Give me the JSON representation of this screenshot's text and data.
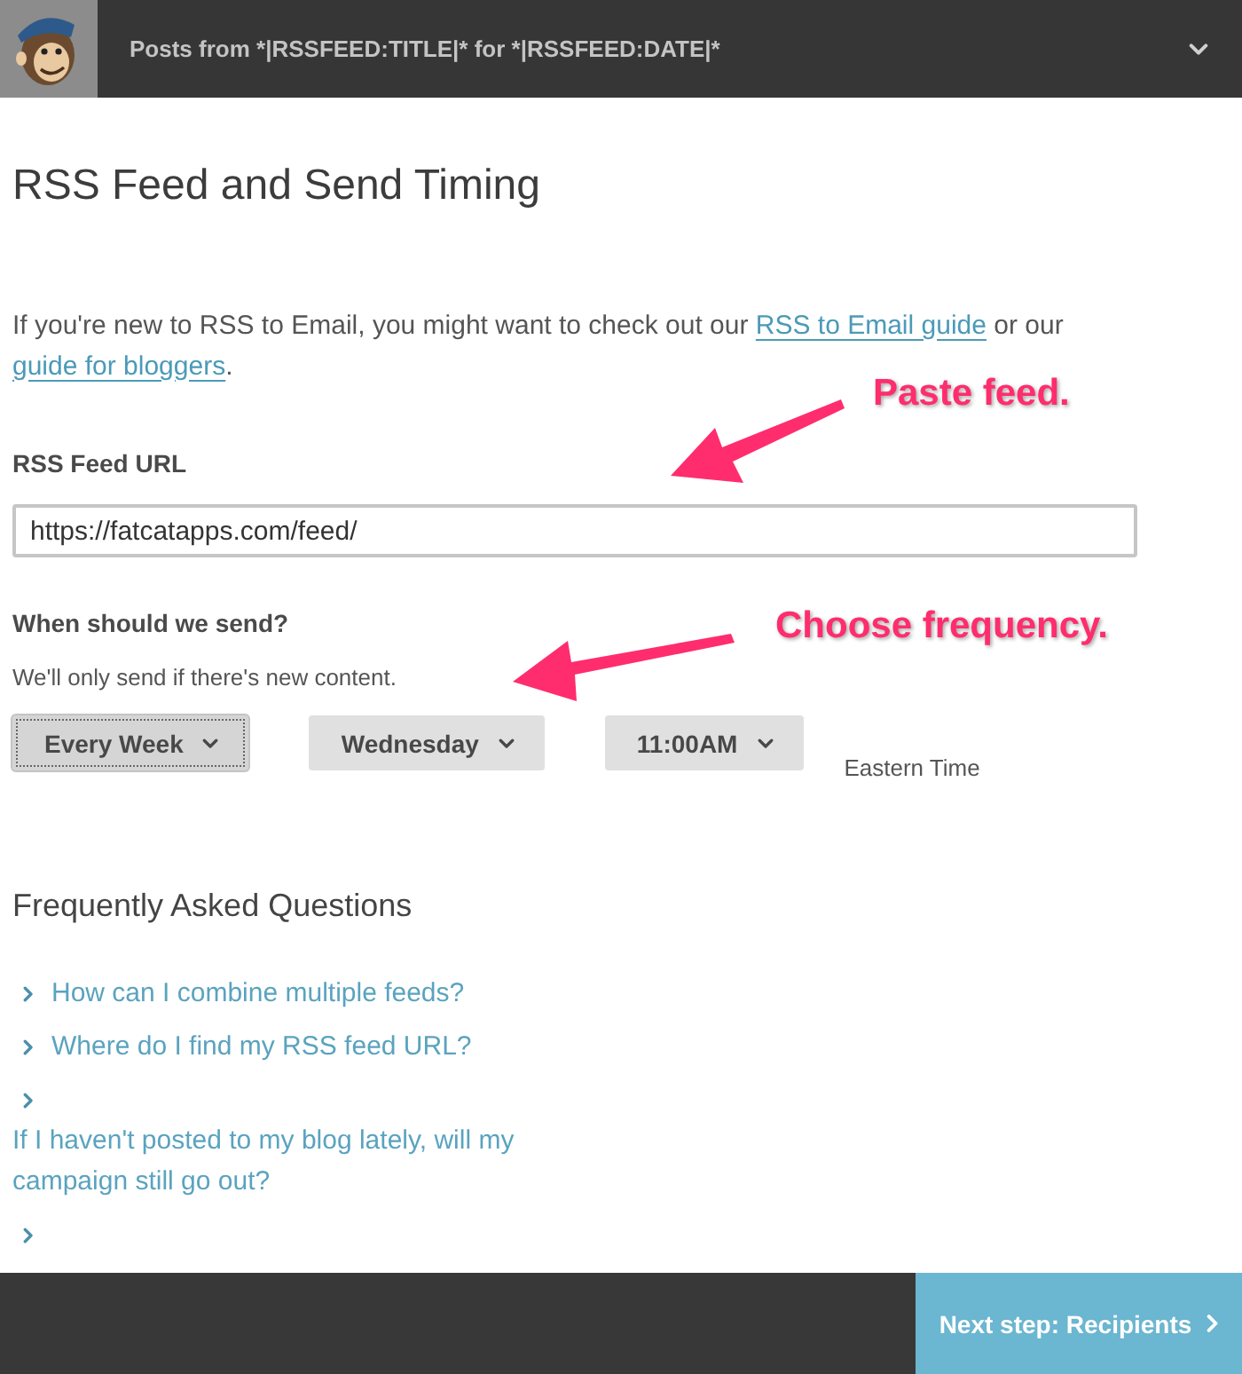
{
  "header": {
    "title": "Posts from *|RSSFEED:TITLE|* for *|RSSFEED:DATE|*"
  },
  "heading": "RSS Feed and Send Timing",
  "intro": [
    {
      "kind": "text",
      "text": "If you're new to RSS to Email, you might want to check out our "
    },
    {
      "kind": "link",
      "text": "RSS to Email guide"
    },
    {
      "kind": "text",
      "text": " or our "
    },
    {
      "kind": "link",
      "text": "guide for bloggers"
    },
    {
      "kind": "text",
      "text": "."
    }
  ],
  "feed_url": {
    "label": "RSS Feed URL",
    "value": "https://fatcatapps.com/feed/"
  },
  "schedule": {
    "title": "When should we send?",
    "note": "We'll only send if there's new content.",
    "selects": [
      {
        "value": "Every Week",
        "focused": true
      },
      {
        "value": "Wednesday",
        "focused": false
      },
      {
        "value": "11:00AM",
        "focused": false
      }
    ],
    "timezone": "Eastern Time"
  },
  "faq": {
    "title": "Frequently Asked Questions",
    "items": [
      {
        "kind": "question",
        "text": "How can I combine multiple feeds?"
      },
      {
        "kind": "question",
        "text": "Where do I find my RSS feed URL?"
      },
      {
        "kind": "question",
        "text": "If I haven't posted to my blog lately, will my campaign still go out?"
      },
      {
        "kind": "cut-off"
      }
    ]
  },
  "annotations": [
    {
      "text": "Paste feed."
    },
    {
      "text": "Choose frequency."
    }
  ],
  "footer": {
    "next_button": "Next step: Recipients"
  }
}
